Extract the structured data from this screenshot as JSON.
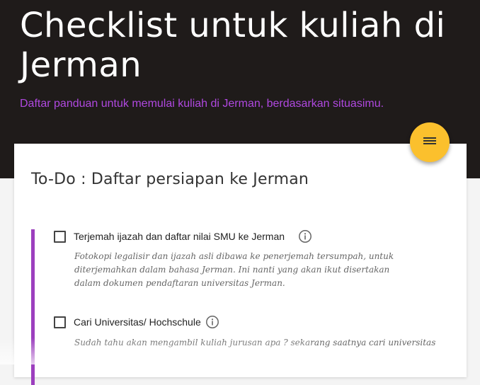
{
  "header": {
    "title": "Checklist untuk kuliah di Jerman",
    "subtitle": "Daftar panduan untuk memulai kuliah di Jerman, berdasarkan situasimu."
  },
  "fab": {
    "icon": "menu-icon",
    "color": "#fbc02d"
  },
  "card": {
    "title": "To-Do : Daftar persiapan ke Jerman",
    "items": [
      {
        "label": "Terjemah ijazah dan daftar nilai SMU ke Jerman",
        "description": "Fotokopi legalisir dan ijazah asli dibawa ke penerjemah tersumpah, untuk diterjemahkan dalam bahasa Jerman. Ini nanti yang akan ikut disertakan dalam dokumen pendaftaran universitas Jerman.",
        "checked": false,
        "info_icon": "info-icon"
      },
      {
        "label": "Cari Universitas/ Hochschule",
        "description": "Sudah tahu akan mengambil kuliah jurusan apa ? sekarang saatnya cari universitas",
        "checked": false,
        "info_icon": "info-icon"
      }
    ]
  },
  "colors": {
    "header_bg": "#1f1b1a",
    "accent_purple": "#9c3fbe",
    "subtitle_purple": "#b048e0",
    "fab_yellow": "#fbc02d"
  }
}
